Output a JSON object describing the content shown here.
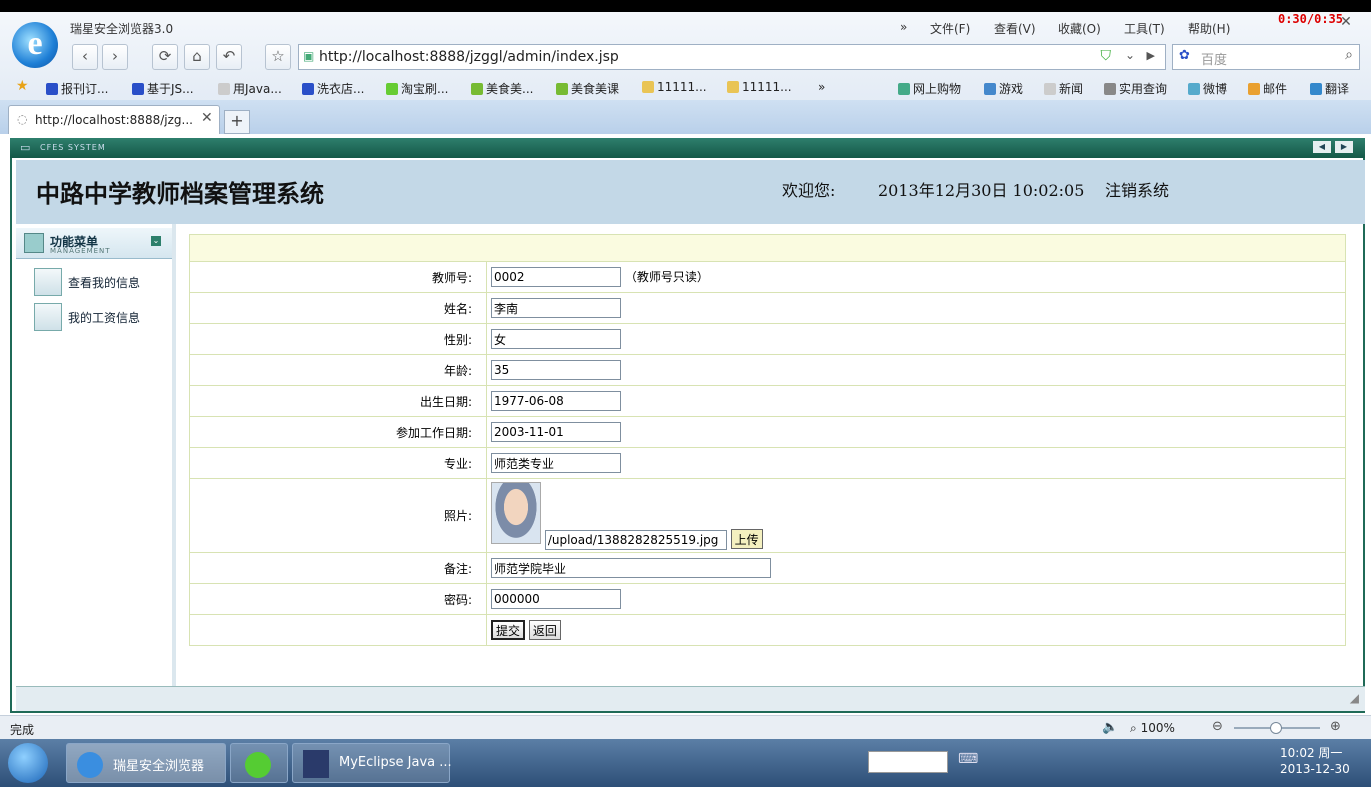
{
  "browser": {
    "app_title": "瑞星安全浏览器3.0",
    "menu": [
      "文件(F)",
      "查看(V)",
      "收藏(O)",
      "工具(T)",
      "帮助(H)"
    ],
    "timer": "0:30/0:35",
    "address": "http://localhost:8888/jzggl/admin/index.jsp",
    "search_placeholder": "百度",
    "favorites": [
      "报刊订...",
      "基于JS...",
      "用Java...",
      "洗衣店...",
      "淘宝刷...",
      "美食美...",
      "美食美课",
      "11111...",
      "11111..."
    ],
    "favorites_more": "»",
    "quick_links": [
      "网上购物",
      "游戏",
      "新闻",
      "实用查询",
      "微博",
      "邮件",
      "翻译"
    ],
    "tab_title": "http://localhost:8888/jzg...",
    "status": "完成",
    "zoom": "100%"
  },
  "page": {
    "sysbar_text": "CFES SYSTEM",
    "title": "中路中学教师档案管理系统",
    "welcome": "欢迎您:",
    "datetime": "2013年12月30日  10:02:05",
    "logout": "注销系统",
    "menu_title": "功能菜单",
    "menu_subtitle": "MANAGEMENT",
    "menu_items": [
      "查看我的信息",
      "我的工资信息"
    ]
  },
  "form": {
    "fields": [
      {
        "label": "教师号:",
        "value": "0002",
        "note": "（教师号只读）"
      },
      {
        "label": "姓名:",
        "value": "李南"
      },
      {
        "label": "性别:",
        "value": "女"
      },
      {
        "label": "年龄:",
        "value": "35"
      },
      {
        "label": "出生日期:",
        "value": "1977-06-08"
      },
      {
        "label": "参加工作日期:",
        "value": "2003-11-01"
      },
      {
        "label": "专业:",
        "value": "师范类专业"
      }
    ],
    "photo_label": "照片:",
    "photo_path": "/upload/1388282825519.jpg",
    "upload_label": "上传",
    "remark_label": "备注:",
    "remark_value": "师范学院毕业",
    "password_label": "密码:",
    "password_value": "000000",
    "submit_label": "提交",
    "back_label": "返回"
  },
  "taskbar": {
    "items": [
      "瑞星安全浏览器",
      "",
      "MyEclipse Java ..."
    ],
    "clock_time": "10:02 周一",
    "clock_date": "2013-12-30"
  }
}
